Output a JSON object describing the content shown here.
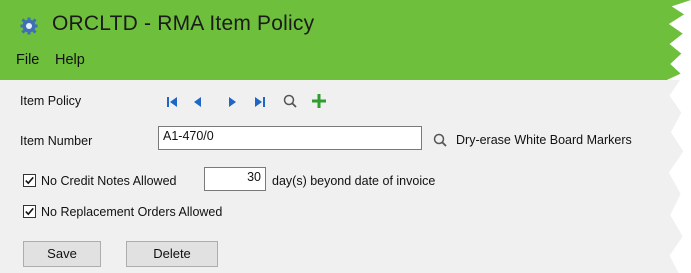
{
  "window": {
    "title": "ORCLTD - RMA Item Policy"
  },
  "menu": {
    "file": "File",
    "help": "Help"
  },
  "form": {
    "item_policy_label": "Item Policy",
    "item_number_label": "Item Number",
    "item_number_value": "A1-470/0",
    "item_description": "Dry-erase White Board Markers",
    "no_credit_notes_label": "No Credit Notes Allowed",
    "no_credit_notes_checked": true,
    "days_value": "30",
    "days_suffix": "day(s) beyond date of invoice",
    "no_replacement_label": "No Replacement Orders Allowed",
    "no_replacement_checked": true
  },
  "buttons": {
    "save": "Save",
    "delete": "Delete"
  },
  "icons": {
    "app": "gear-icon",
    "first": "first-record-icon",
    "prev": "previous-record-icon",
    "next": "next-record-icon",
    "last": "last-record-icon",
    "finder": "search-icon",
    "add": "add-icon",
    "item_finder": "search-icon"
  },
  "colors": {
    "title_band": "#6ebf3b",
    "nav_arrows": "#1e66c8",
    "add": "#2e9e2e"
  }
}
